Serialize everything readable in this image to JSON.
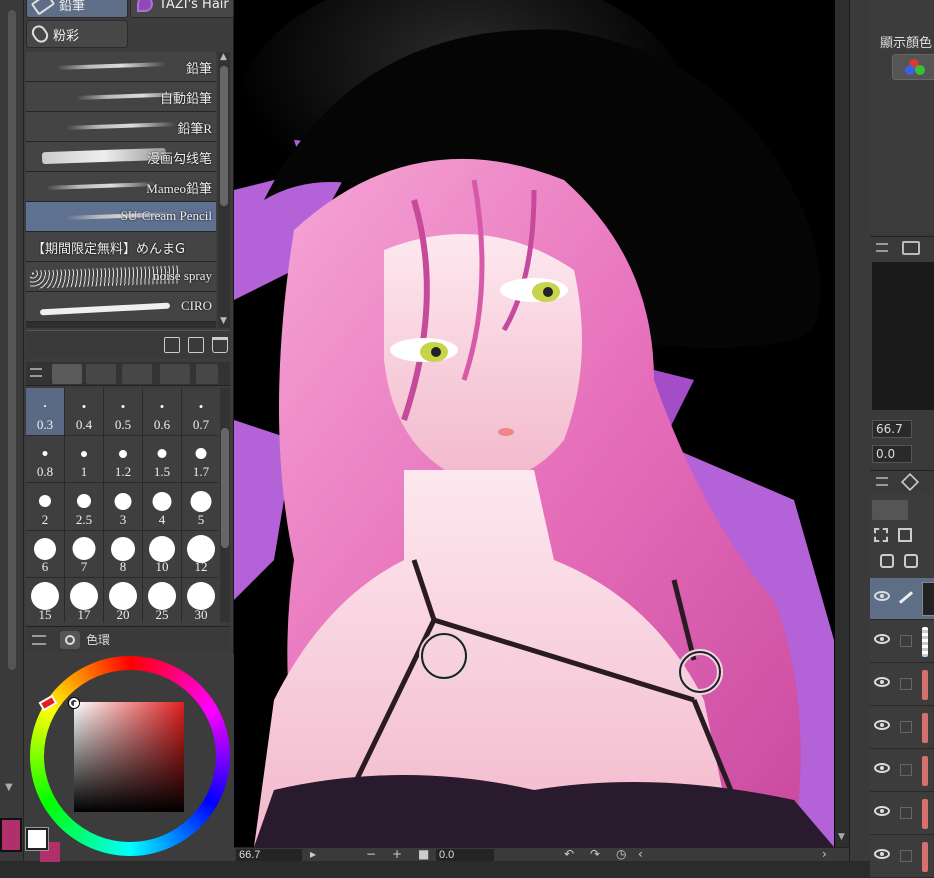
{
  "brush_tabs": [
    {
      "label": "鉛筆",
      "icon": "pencil-icon",
      "active": true
    },
    {
      "label": "TAZI's Hair",
      "icon": "brush-tip-icon",
      "active": false
    },
    {
      "label": "粉彩",
      "icon": "pastel-icon",
      "active": false
    }
  ],
  "brushes": [
    {
      "label": "鉛筆"
    },
    {
      "label": "自動鉛筆"
    },
    {
      "label": "鉛筆R"
    },
    {
      "label": "漫画勾线笔"
    },
    {
      "label": "Mameo鉛筆"
    },
    {
      "label": "SU-Cream Pencil",
      "selected": true
    },
    {
      "label": "【期間限定無料】めんまG"
    },
    {
      "label": "noise spray"
    },
    {
      "label": "CIRO"
    }
  ],
  "brush_sizes": [
    {
      "label": "0.3",
      "selected": true
    },
    {
      "label": "0.4"
    },
    {
      "label": "0.5"
    },
    {
      "label": "0.6"
    },
    {
      "label": "0.7"
    },
    {
      "label": "0.8"
    },
    {
      "label": "1"
    },
    {
      "label": "1.2"
    },
    {
      "label": "1.5"
    },
    {
      "label": "1.7"
    },
    {
      "label": "2"
    },
    {
      "label": "2.5"
    },
    {
      "label": "3"
    },
    {
      "label": "4"
    },
    {
      "label": "5"
    },
    {
      "label": "6"
    },
    {
      "label": "7"
    },
    {
      "label": "8"
    },
    {
      "label": "10"
    },
    {
      "label": "12"
    },
    {
      "label": "15"
    },
    {
      "label": "17"
    },
    {
      "label": "20"
    },
    {
      "label": "25"
    },
    {
      "label": "30"
    }
  ],
  "color_panel": {
    "title": "色環",
    "main_color": "#b0306b",
    "hue_color": "#e02020"
  },
  "statusbar": {
    "zoom": "66.7",
    "angle": "0.0"
  },
  "right_panel": {
    "color_label": "顯示顏色",
    "nav_zoom": "66.7",
    "nav_angle": "0.0"
  }
}
